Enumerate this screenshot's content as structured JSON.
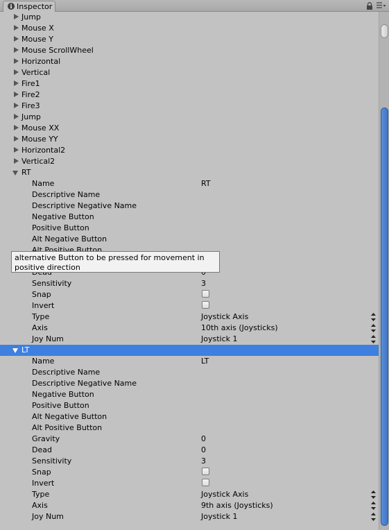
{
  "window": {
    "tab_title": "Inspector"
  },
  "axes_collapsed": [
    "Jump",
    "Mouse X",
    "Mouse Y",
    "Mouse ScrollWheel",
    "Horizontal",
    "Vertical",
    "Fire1",
    "Fire2",
    "Fire3",
    "Jump",
    "Mouse XX",
    "Mouse YY",
    "Horizontal2",
    "Vertical2"
  ],
  "rt": {
    "label": "RT",
    "name_label": "Name",
    "name_value": "RT",
    "descriptive_name_label": "Descriptive Name",
    "descriptive_negative_name_label": "Descriptive Negative Name",
    "negative_button_label": "Negative Button",
    "positive_button_label": "Positive Button",
    "alt_negative_button_label": "Alt Negative Button",
    "alt_positive_button_label": "Alt Positive Button",
    "dead_label": "Dead",
    "dead_value": "0",
    "sensitivity_label": "Sensitivity",
    "sensitivity_value": "3",
    "snap_label": "Snap",
    "invert_label": "Invert",
    "type_label": "Type",
    "type_value": "Joystick Axis",
    "axis_label": "Axis",
    "axis_value": "10th axis (Joysticks)",
    "joy_num_label": "Joy Num",
    "joy_num_value": "Joystick 1"
  },
  "lt": {
    "label": "LT",
    "name_label": "Name",
    "name_value": "LT",
    "descriptive_name_label": "Descriptive Name",
    "descriptive_negative_name_label": "Descriptive Negative Name",
    "negative_button_label": "Negative Button",
    "positive_button_label": "Positive Button",
    "alt_negative_button_label": "Alt Negative Button",
    "alt_positive_button_label": "Alt Positive Button",
    "gravity_label": "Gravity",
    "gravity_value": "0",
    "dead_label": "Dead",
    "dead_value": "0",
    "sensitivity_label": "Sensitivity",
    "sensitivity_value": "3",
    "snap_label": "Snap",
    "invert_label": "Invert",
    "type_label": "Type",
    "type_value": "Joystick Axis",
    "axis_label": "Axis",
    "axis_value": "9th axis (Joysticks)",
    "joy_num_label": "Joy Num",
    "joy_num_value": "Joystick 1"
  },
  "tooltip": {
    "text": "alternative Button to be pressed for movement in positive direction"
  },
  "colors": {
    "selection": "#3d80df",
    "panel": "#c2c2c2",
    "scroll_thumb": "#4a80cf"
  }
}
